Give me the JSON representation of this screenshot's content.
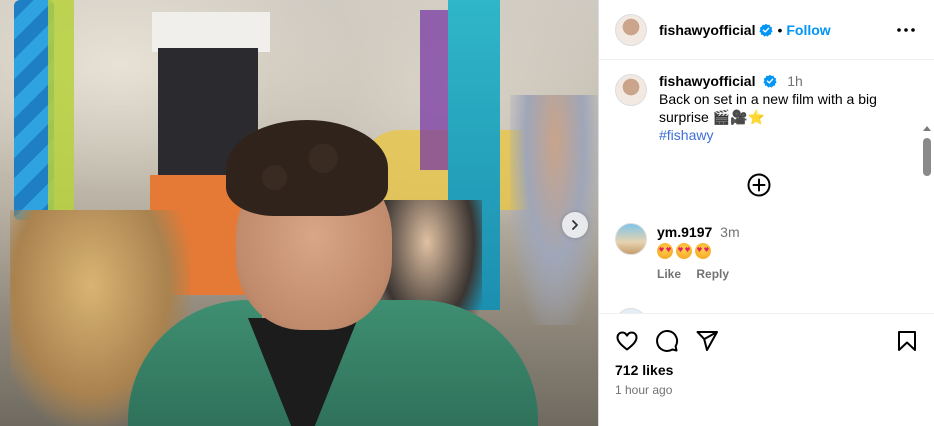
{
  "post": {
    "author": "fishawyofficial",
    "follow_label": "Follow",
    "separator": "•",
    "caption": {
      "author": "fishawyofficial",
      "time": "1h",
      "text": "Back on set in a new film with a big surprise 🎬🎥⭐",
      "hashtag": "#fishawy"
    },
    "comments": [
      {
        "author": "ym.9197",
        "time": "3m",
        "text": "🤩🤩🤩",
        "like_label": "Like",
        "reply_label": "Reply"
      }
    ],
    "likes": "712 likes",
    "posted": "1 hour ago"
  },
  "icons": {
    "more": "more-options-icon",
    "add_comment": "add-circle-icon",
    "like": "heart-icon",
    "comment": "comment-icon",
    "share": "share-icon",
    "save": "bookmark-icon",
    "next": "chevron-right-icon",
    "verified": "verified-badge-icon"
  },
  "colors": {
    "link": "#0095f6",
    "secondary_text": "#737373",
    "hashtag": "#3d6fd6"
  }
}
